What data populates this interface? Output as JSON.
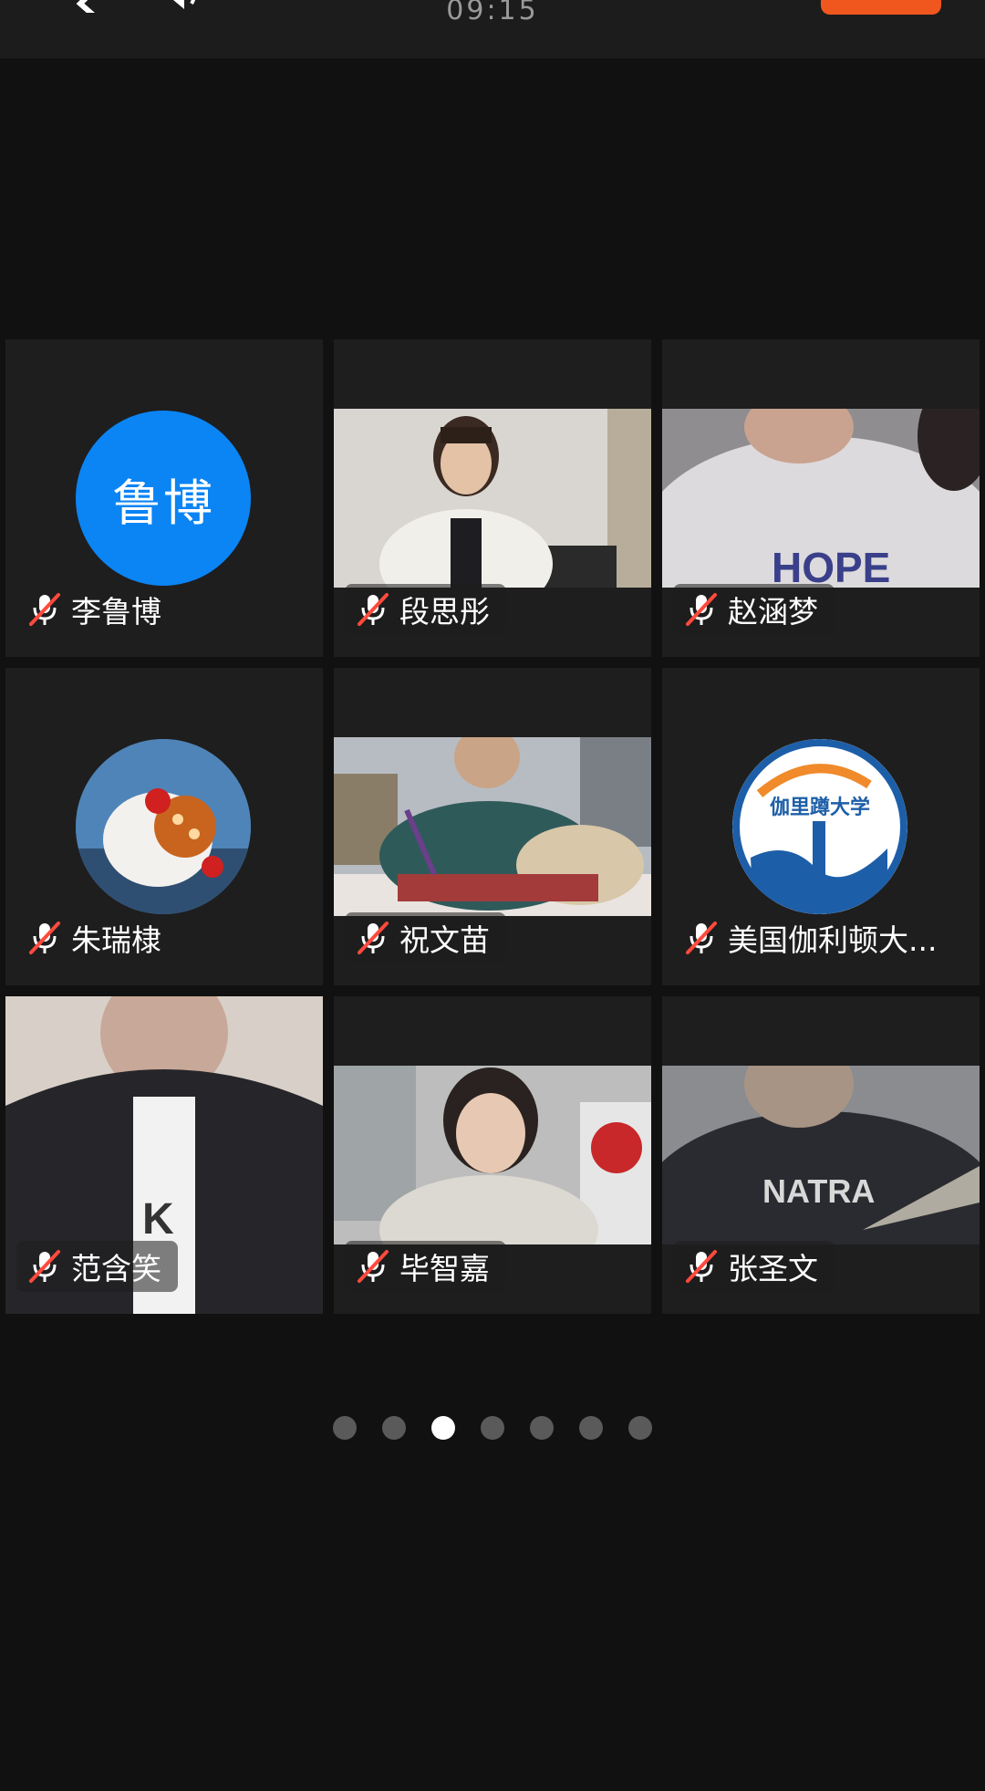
{
  "header": {
    "timer": "09:15",
    "back_icon": "chevron-left-icon",
    "speaker_icon": "speaker-icon",
    "end_button_color": "#f0571f"
  },
  "participants": [
    {
      "name": "李鲁博",
      "avatar_text": "鲁博",
      "avatar_color": "#0b84f4",
      "muted": true
    },
    {
      "name": "段思彤",
      "muted": true
    },
    {
      "name": "赵涵梦",
      "muted": true
    },
    {
      "name": "朱瑞棣",
      "muted": true
    },
    {
      "name": "祝文苗",
      "muted": true
    },
    {
      "name": "美国伽利顿大...",
      "logo_text": "伽里蹲大学",
      "muted": true
    },
    {
      "name": "范含笑",
      "muted": true
    },
    {
      "name": "毕智嘉",
      "muted": true
    },
    {
      "name": "张圣文",
      "muted": true
    }
  ],
  "pagination": {
    "total": 7,
    "current": 3
  },
  "colors": {
    "background": "#111111",
    "tile": "#1e1e1e",
    "muted_slash": "#ff4a3d"
  }
}
